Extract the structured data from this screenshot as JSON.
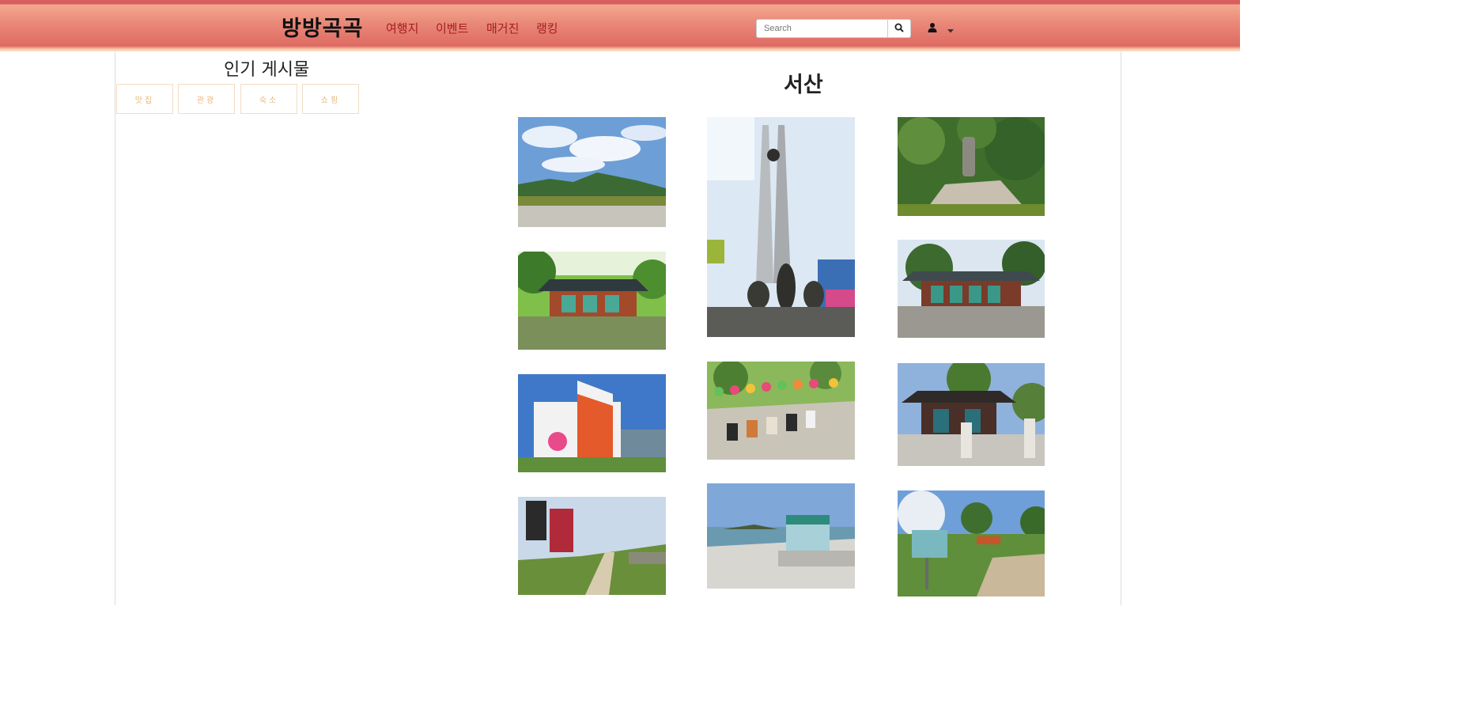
{
  "header": {
    "brand": "방방곡곡",
    "nav": [
      "여행지",
      "이벤트",
      "매거진",
      "랭킹"
    ],
    "search_placeholder": "Search"
  },
  "sidebar": {
    "title": "인기 게시물",
    "categories": [
      "맛집",
      "관광",
      "숙소",
      "쇼핑"
    ]
  },
  "main": {
    "title": "서산"
  },
  "colors": {
    "header_top": "#d95f5f",
    "header_mid": "#e98878",
    "nav_link": "#a41f1f",
    "category_text": "#e8b878",
    "category_border": "#f2dcc4"
  }
}
